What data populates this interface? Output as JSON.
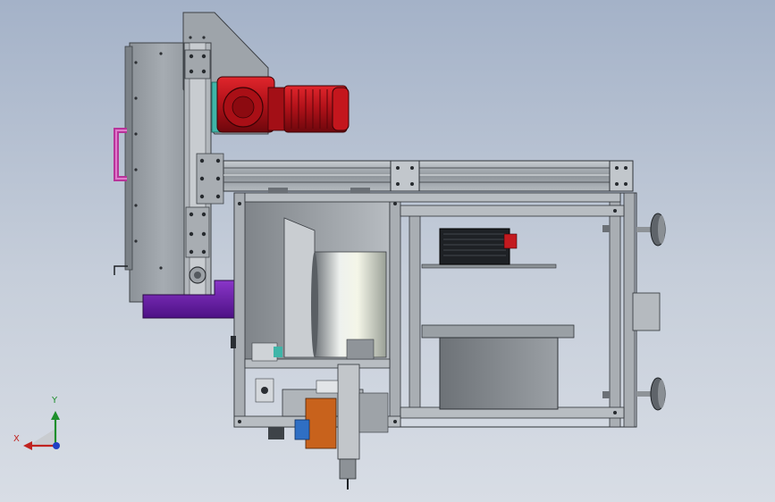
{
  "viewport": {
    "background_top": "#a4b2c8",
    "background_bottom": "#d8dde5"
  },
  "model": {
    "components": [
      "left-frame-plate",
      "vertical-rail",
      "gear-motor",
      "top-aluminum-beam",
      "main-frame",
      "drum-roller",
      "purple-bracket",
      "magenta-handle",
      "stepper-motor",
      "gray-box",
      "lower-mechanism",
      "leveling-feet"
    ],
    "colors": {
      "frame_gray": "#9aa0a6",
      "motor_red": "#c0151b",
      "bracket_purple": "#6a1fa2",
      "handle_magenta": "#b8349a",
      "coupling_teal": "#3fb5a8",
      "mechanism_orange": "#c8621c",
      "mechanism_blue": "#2f6fc4"
    }
  },
  "triad": {
    "x_label": "X",
    "y_label": "Y",
    "x_color": "#c0231f",
    "y_color": "#1e8f2c",
    "z_color": "#1f3fc4"
  }
}
